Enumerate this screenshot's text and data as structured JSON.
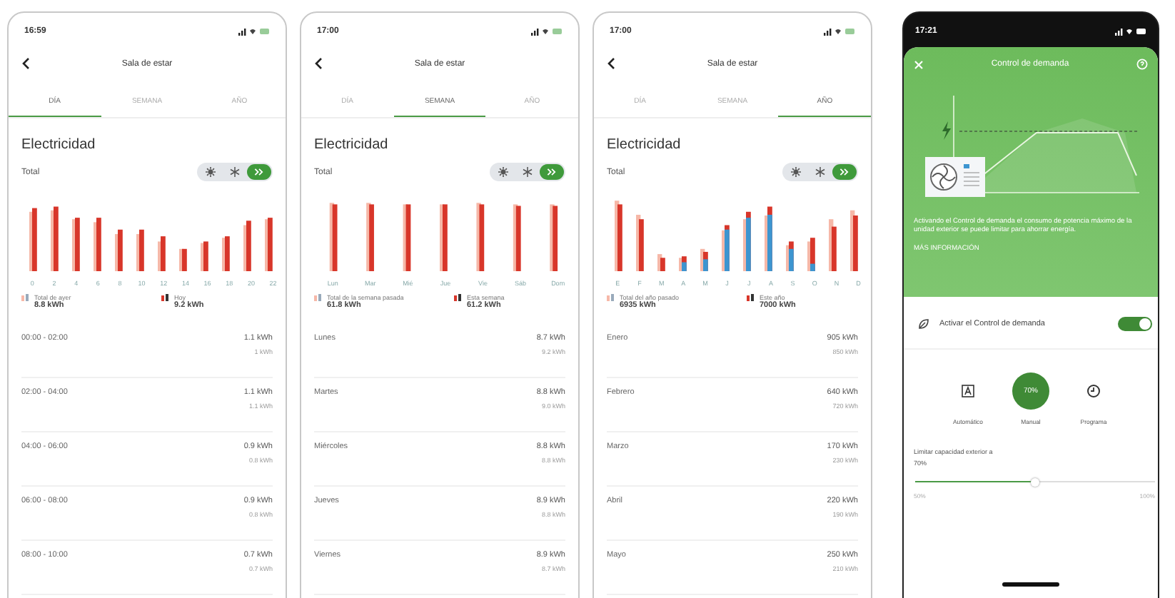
{
  "phones": [
    {
      "status_time": "16:59",
      "title": "Sala de estar",
      "tabs": [
        {
          "label": "DÍA",
          "selected": true
        },
        {
          "label": "SEMANA",
          "selected": false
        },
        {
          "label": "AÑO",
          "selected": false
        }
      ],
      "heading": "Electricidad",
      "subheading": "Total",
      "modes": [
        {
          "kind": "heat",
          "selected": false
        },
        {
          "kind": "cool",
          "selected": false
        },
        {
          "kind": "auto",
          "selected": true
        }
      ],
      "chart_labels": [
        "0",
        "2",
        "4",
        "6",
        "8",
        "10",
        "12",
        "14",
        "16",
        "18",
        "20",
        "22"
      ],
      "legend": [
        {
          "label": "Total de ayer",
          "value": "8.8 kWh"
        },
        {
          "label": "Hoy",
          "value": "9.2 kWh"
        }
      ],
      "rows": [
        {
          "label": "00:00 - 02:00",
          "value": "1.1 kWh",
          "previous": "1 kWh"
        },
        {
          "label": "02:00 - 04:00",
          "value": "1.1 kWh",
          "previous": "1.1 kWh"
        },
        {
          "label": "04:00 - 06:00",
          "value": "0.9 kWh",
          "previous": "0.8 kWh"
        },
        {
          "label": "06:00 - 08:00",
          "value": "0.9 kWh",
          "previous": "0.8 kWh"
        },
        {
          "label": "08:00 - 10:00",
          "value": "0.7 kWh",
          "previous": "0.7 kWh"
        }
      ]
    },
    {
      "status_time": "17:00",
      "title": "Sala de estar",
      "tabs": [
        {
          "label": "DÍA",
          "selected": false
        },
        {
          "label": "SEMANA",
          "selected": true
        },
        {
          "label": "AÑO",
          "selected": false
        }
      ],
      "heading": "Electricidad",
      "subheading": "Total",
      "modes": [
        {
          "kind": "heat",
          "selected": false
        },
        {
          "kind": "cool",
          "selected": false
        },
        {
          "kind": "auto",
          "selected": true
        }
      ],
      "chart_labels": [
        "Lun",
        "Mar",
        "Mié",
        "Jue",
        "Vie",
        "Sáb",
        "Dom"
      ],
      "legend": [
        {
          "label": "Total de la semana pasada",
          "value": "61.8 kWh"
        },
        {
          "label": "Esta semana",
          "value": "61.2 kWh"
        }
      ],
      "rows": [
        {
          "label": "Lunes",
          "value": "8.7 kWh",
          "previous": "9.2 kWh"
        },
        {
          "label": "Martes",
          "value": "8.8 kWh",
          "previous": "9.0 kWh"
        },
        {
          "label": "Miércoles",
          "value": "8.8 kWh",
          "previous": "8.8 kWh"
        },
        {
          "label": "Jueves",
          "value": "8.9 kWh",
          "previous": "8.8 kWh"
        },
        {
          "label": "Viernes",
          "value": "8.9 kWh",
          "previous": "8.7 kWh"
        }
      ]
    },
    {
      "status_time": "17:00",
      "title": "Sala de estar",
      "tabs": [
        {
          "label": "DÍA",
          "selected": false
        },
        {
          "label": "SEMANA",
          "selected": false
        },
        {
          "label": "AÑO",
          "selected": true
        }
      ],
      "heading": "Electricidad",
      "subheading": "Total",
      "modes": [
        {
          "kind": "heat",
          "selected": false
        },
        {
          "kind": "cool",
          "selected": false
        },
        {
          "kind": "auto",
          "selected": true
        }
      ],
      "chart_labels": [
        "E",
        "F",
        "M",
        "A",
        "M",
        "J",
        "J",
        "A",
        "S",
        "O",
        "N",
        "D"
      ],
      "legend": [
        {
          "label": "Total del año pasado",
          "value": "6935 kWh"
        },
        {
          "label": "Este año",
          "value": "7000 kWh"
        }
      ],
      "rows": [
        {
          "label": "Enero",
          "value": "905 kWh",
          "previous": "850 kWh"
        },
        {
          "label": "Febrero",
          "value": "640 kWh",
          "previous": "720 kWh"
        },
        {
          "label": "Marzo",
          "value": "170 kWh",
          "previous": "230 kWh"
        },
        {
          "label": "Abril",
          "value": "220 kWh",
          "previous": "190 kWh"
        },
        {
          "label": "Mayo",
          "value": "250 kWh",
          "previous": "210 kWh"
        }
      ]
    }
  ],
  "control": {
    "status_time": "17:21",
    "title": "Control de demanda",
    "description": "Activando el Control de demanda el consumo de potencia máximo de la unidad exterior se puede limitar para ahorrar energía.",
    "more_info": "MÁS INFORMACIÓN",
    "switch_label": "Activar el Control de demanda",
    "switch_on": true,
    "options": [
      {
        "kind": "auto",
        "label": "Automático",
        "selected": false
      },
      {
        "kind": "manual",
        "label": "Manual",
        "selected": true,
        "value": "70%"
      },
      {
        "kind": "schedule",
        "label": "Programa",
        "selected": false
      }
    ],
    "limit_label": "Limitar capacidad exterior a",
    "limit_value": "70%",
    "slider": {
      "level": 0.5,
      "min_label": "50%",
      "max_label": "100%"
    }
  }
}
